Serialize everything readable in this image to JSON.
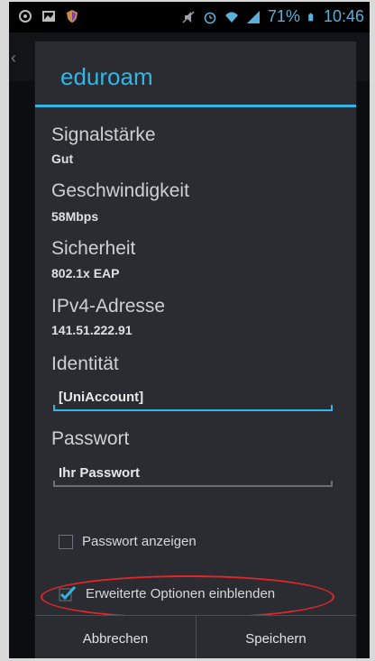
{
  "status_bar": {
    "left_icons": [
      "usb-icon",
      "image-icon",
      "shield-icon"
    ],
    "right_icons": [
      "mute-icon",
      "alarm-icon",
      "wifi-icon",
      "signal-icon"
    ],
    "battery_percent": "71%",
    "time": "10:46"
  },
  "background": {
    "back_glyph": "‹"
  },
  "dialog": {
    "title": "eduroam",
    "signal_label": "Signalstärke",
    "signal_value": "Gut",
    "speed_label": "Geschwindigkeit",
    "speed_value": "58Mbps",
    "security_label": "Sicherheit",
    "security_value": "802.1x EAP",
    "ip_label": "IPv4-Adresse",
    "ip_value": "141.51.222.91",
    "identity_label": "Identität",
    "identity_value": "[UniAccount]",
    "password_label": "Passwort",
    "password_value": "Ihr Passwort",
    "show_password_label": "Passwort anzeigen",
    "show_password_checked": false,
    "advanced_label": "Erweiterte Optionen einblenden",
    "advanced_checked": true,
    "cancel_label": "Abbrechen",
    "save_label": "Speichern"
  },
  "colors": {
    "accent": "#33b5e5",
    "highlight": "#e2262a"
  }
}
